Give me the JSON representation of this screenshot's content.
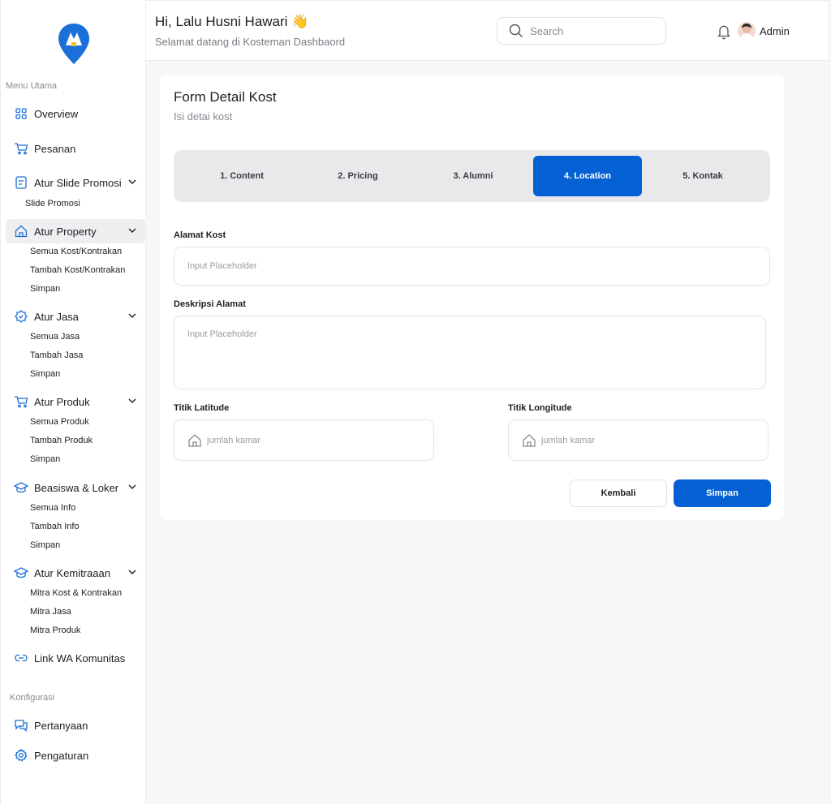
{
  "sidebar": {
    "menu_label": "Menu Utama",
    "config_label": "Konfigurasi",
    "items": {
      "overview": "Overview",
      "pesanan": "Pesanan",
      "atur_slide": "Atur Slide Promosi",
      "slide_promosi": "Slide Promosi",
      "atur_property": "Atur Property",
      "semua_kost": "Semua Kost/Kontrakan",
      "tambah_kost": "Tambah Kost/Kontrakan",
      "simpan_property": "Simpan",
      "atur_jasa": "Atur Jasa",
      "semua_jasa": "Semua Jasa",
      "tambah_jasa": "Tambah Jasa",
      "simpan_jasa": "Simpan",
      "atur_produk": "Atur Produk",
      "semua_produk": "Semua Produk",
      "tambah_produk": "Tambah Produk",
      "simpan_produk": "Simpan",
      "beasiswa": "Beasiswa & Loker",
      "semua_info": "Semua Info",
      "tambah_info": "Tambah Info",
      "simpan_info": "Simpan",
      "kemitraan": "Atur Kemitraaan",
      "mitra_kost": "Mitra Kost & Kontrakan",
      "mitra_jasa": "Mitra Jasa",
      "mitra_produk": "Mitra Produk",
      "link_wa": "Link WA Komunitas",
      "pertanyaan": "Pertanyaan",
      "pengaturan": "Pengaturan"
    }
  },
  "header": {
    "greeting": "Hi, Lalu Husni Hawari 👋",
    "subtitle": "Selamat datang di Kosteman Dashbaord",
    "search_placeholder": "Search",
    "user_name": "Admin"
  },
  "form": {
    "title": "Form Detail Kost",
    "subtitle": "Isi detai kost",
    "steps": [
      "1. Content",
      "2. Pricing",
      "3. Alumni",
      "4. Location",
      "5. Kontak"
    ],
    "active_step": "4. Location",
    "alamat_label": "Alamat Kost",
    "alamat_placeholder": "Input Placeholder",
    "deskripsi_label": "Deskripsi Alamat",
    "deskripsi_placeholder": "Input Placeholder",
    "lat_label": "Titik Latitude",
    "lat_placeholder": "jumlah kamar",
    "lng_label": "Titik Longitude",
    "lng_placeholder": "jumlah kamar",
    "back_label": "Kembali",
    "save_label": "Simpan"
  },
  "colors": {
    "accent": "#0561d3",
    "active_nav_bg": "#efeff2",
    "steps_bg": "#e9e9ec"
  }
}
